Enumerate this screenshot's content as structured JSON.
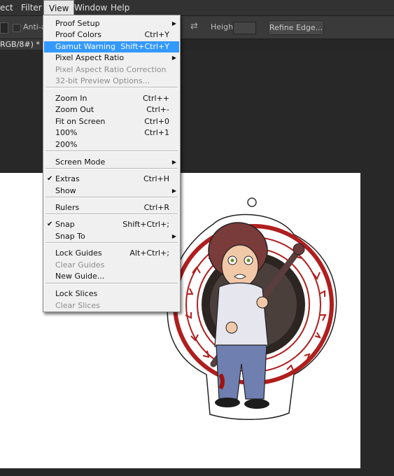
{
  "menubar": {
    "items": [
      "ect",
      "Filter",
      "View",
      "Window",
      "Help"
    ],
    "active": "View"
  },
  "options_bar": {
    "antialias_label": "Anti-ali",
    "height_label": "Height:",
    "refine_button": "Refine Edge..."
  },
  "doc_tab": {
    "title": "RGB/8#) *",
    "close": "×"
  },
  "view_menu": {
    "items": [
      {
        "label": "Proof Setup",
        "shortcut": "",
        "submenu": true
      },
      {
        "label": "Proof Colors",
        "shortcut": "Ctrl+Y"
      },
      {
        "label": "Gamut Warning",
        "shortcut": "Shift+Ctrl+Y",
        "highlighted": true
      },
      {
        "label": "Pixel Aspect Ratio",
        "shortcut": "",
        "submenu": true
      },
      {
        "label": "Pixel Aspect Ratio Correction",
        "shortcut": "",
        "disabled": true
      },
      {
        "label": "32-bit Preview Options...",
        "shortcut": "",
        "disabled": true
      },
      {
        "label": "Zoom In",
        "shortcut": "Ctrl++"
      },
      {
        "label": "Zoom Out",
        "shortcut": "Ctrl+-"
      },
      {
        "label": "Fit on Screen",
        "shortcut": "Ctrl+0"
      },
      {
        "label": "100%",
        "shortcut": "Ctrl+1"
      },
      {
        "label": "200%",
        "shortcut": ""
      },
      {
        "label": "Screen Mode",
        "shortcut": "",
        "submenu": true
      },
      {
        "label": "Extras",
        "shortcut": "Ctrl+H",
        "checked": true
      },
      {
        "label": "Show",
        "shortcut": "",
        "submenu": true
      },
      {
        "label": "Rulers",
        "shortcut": "Ctrl+R"
      },
      {
        "label": "Snap",
        "shortcut": "Shift+Ctrl+;",
        "checked": true
      },
      {
        "label": "Snap To",
        "shortcut": "",
        "submenu": true
      },
      {
        "label": "Lock Guides",
        "shortcut": "Alt+Ctrl+;"
      },
      {
        "label": "Clear Guides",
        "shortcut": "",
        "disabled": true
      },
      {
        "label": "New Guide...",
        "shortcut": ""
      },
      {
        "label": "Lock Slices",
        "shortcut": ""
      },
      {
        "label": "Clear Slices",
        "shortcut": "",
        "disabled": true
      }
    ]
  },
  "colors": {
    "highlight": "#3399ff",
    "menu_bg": "#f0f0f0",
    "workspace": "#282828",
    "canvas": "#ffffff",
    "seal_red": "#b01e1e"
  }
}
